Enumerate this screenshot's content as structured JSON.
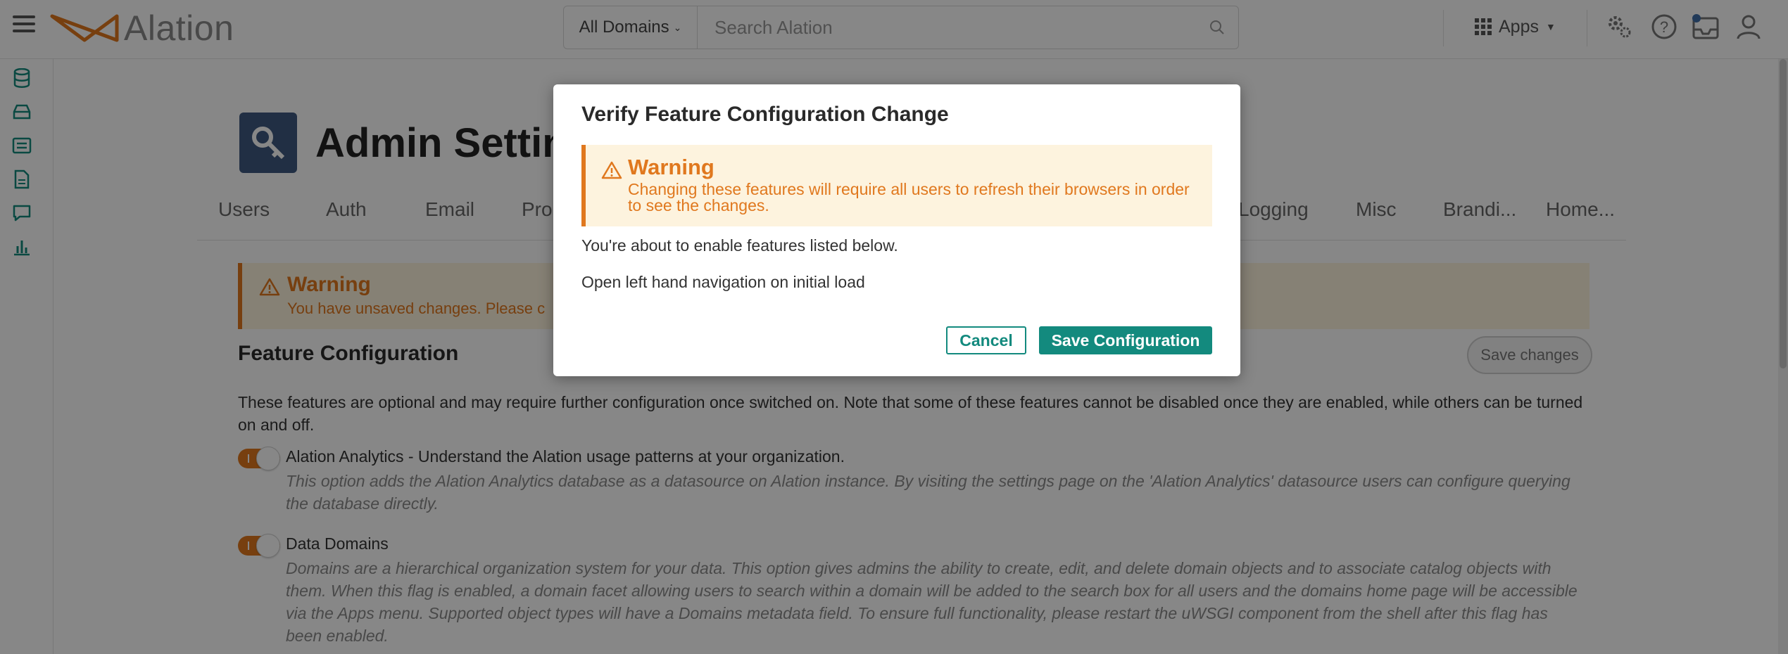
{
  "topbar": {
    "logo_text": "Alation",
    "domain_select": "All Domains",
    "search_placeholder": "Search Alation",
    "apps_label": "Apps"
  },
  "page": {
    "title": "Admin Settings",
    "tabs": [
      "Users",
      "Auth",
      "Email",
      "Pro",
      "Logging",
      "Misc",
      "Brandi...",
      "Home..."
    ],
    "warning": {
      "title": "Warning",
      "text": "You have unsaved changes. Please c"
    },
    "section_title": "Feature Configuration",
    "save_changes_label": "Save changes",
    "section_desc": "These features are optional and may require further configuration once switched on. Note that some of these features cannot be disabled once they are enabled, while others can be turned on and off.",
    "features": [
      {
        "name": "Alation Analytics - Understand the Alation usage patterns at your organization.",
        "desc": "This option adds the Alation Analytics database as a datasource on Alation instance. By visiting the settings page on the 'Alation Analytics' datasource users can configure querying the database directly.",
        "enabled": true
      },
      {
        "name": "Data Domains",
        "desc": "Domains are a hierarchical organization system for your data. This option gives admins the ability to create, edit, and delete domain objects and to associate catalog objects with them. When this flag is enabled, a domain facet allowing users to search within a domain will be added to the search box for all users and the domains home page will be accessible via the Apps menu. Supported object types will have a Domains metadata field. To ensure full functionality, please restart the uWSGI component from the shell after this flag has been enabled.",
        "enabled": true
      }
    ]
  },
  "modal": {
    "title": "Verify Feature Configuration Change",
    "warning_title": "Warning",
    "warning_text": "Changing these features will require all users to refresh their browsers in order to see the changes.",
    "intro": "You're about to enable features listed below.",
    "feature": "Open left hand navigation on initial load",
    "cancel_label": "Cancel",
    "save_label": "Save Configuration"
  },
  "colors": {
    "accent_teal": "#138a7e",
    "warning_orange": "#e0781e",
    "warning_bg": "#fdf3de",
    "page_icon_bg": "#3f5a80"
  },
  "icons": {
    "menu": "hamburger-icon",
    "logo": "alation-logo-icon",
    "search": "search-icon",
    "apps": "grid-icon",
    "admin": "gears-icon",
    "help": "question-icon",
    "inbox": "inbox-icon",
    "user": "user-icon",
    "warning": "warning-triangle-icon",
    "page": "key-icon"
  }
}
